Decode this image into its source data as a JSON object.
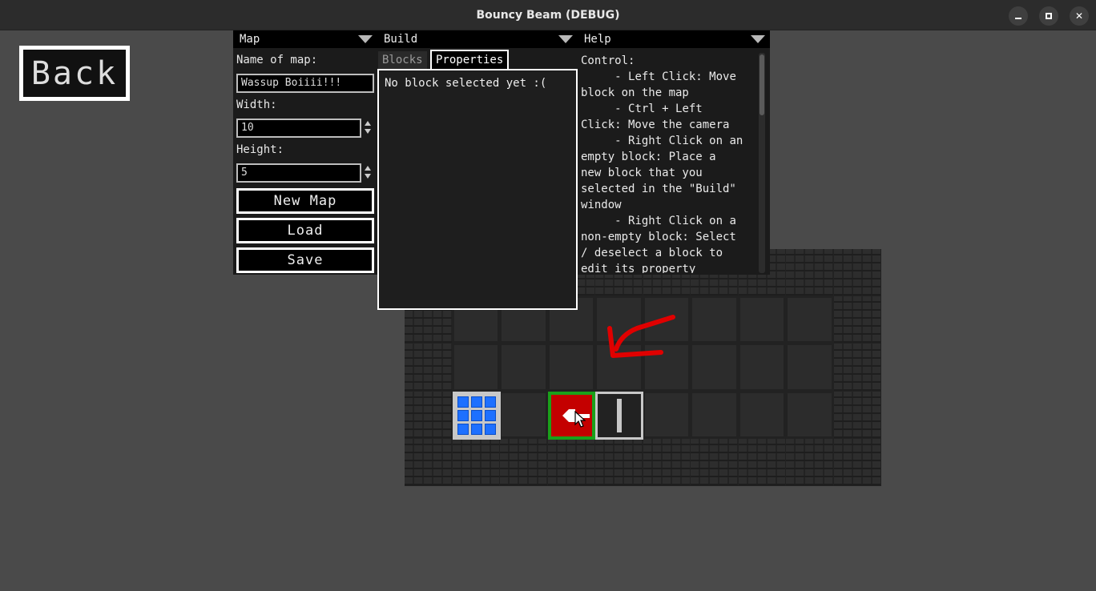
{
  "window": {
    "title": "Bouncy Beam (DEBUG)",
    "minimize_icon": "minimize-icon",
    "maximize_icon": "maximize-icon",
    "close_symbol": "✕"
  },
  "back_button": {
    "label": "Back"
  },
  "map_panel": {
    "header": "Map",
    "name_label": "Name of map:",
    "name_value": "Wassup Boiiii!!!",
    "width_label": "Width:",
    "width_value": "10",
    "height_label": "Height:",
    "height_value": "5",
    "new_map_label": "New Map",
    "load_label": "Load",
    "save_label": "Save"
  },
  "build_panel": {
    "header": "Build",
    "tabs": [
      {
        "label": "Blocks",
        "active": false
      },
      {
        "label": "Properties",
        "active": true
      }
    ],
    "properties_text": "No block selected yet :("
  },
  "help_panel": {
    "header": "Help",
    "text": "Control:\n     - Left Click: Move\nblock on the map\n     - Ctrl + Left\nClick: Move the camera\n     - Right Click on an\nempty block: Place a\nnew block that you\nselected in the \"Build\"\nwindow\n     - Right Click on a\nnon-empty block: Select\n/ deselect a block to\nedit its property"
  },
  "colors": {
    "background": "#4a4a4a",
    "wall_block": "#1565e8",
    "laser_block": "#c40000",
    "laser_border": "#1aa11a",
    "arrow": "#e00000"
  }
}
